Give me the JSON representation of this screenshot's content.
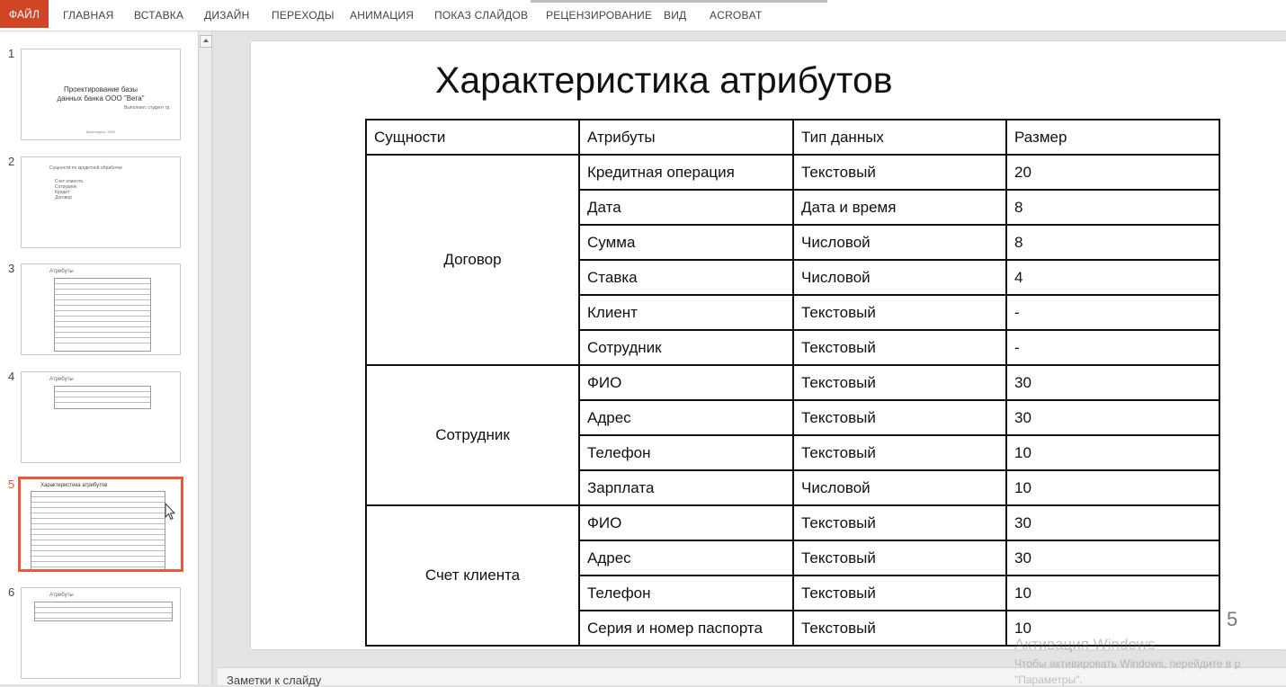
{
  "ribbon": {
    "tabs": [
      "ФАЙЛ",
      "ГЛАВНАЯ",
      "ВСТАВКА",
      "ДИЗАЙН",
      "ПЕРЕХОДЫ",
      "АНИМАЦИЯ",
      "ПОКАЗ СЛАЙДОВ",
      "РЕЦЕНЗИРОВАНИЕ",
      "ВИД",
      "ACROBAT"
    ],
    "active_color": "#d04525"
  },
  "thumbnails": {
    "numbers": [
      "1",
      "2",
      "3",
      "4",
      "5",
      "6"
    ],
    "selected": "5",
    "selected_color": "#e8593a",
    "s1_title": "Проектирование базы данных банка ООО \"Вега\"",
    "s1_author": "Выполнил: студент гр.",
    "s1_footer": "Красноярск, 2020",
    "s2_title": "Сущности по кредитной обработке",
    "s2_bullets": [
      "Счет клиента",
      "Сотрудник",
      "Кредит",
      "Договор"
    ],
    "s3_title": "Атрибуты",
    "s4_title": "Атрибуты",
    "s5_title": "Характеристика атрибутов",
    "s6_title": "Атрибуты"
  },
  "slide": {
    "title": "Характеристика атрибутов",
    "number": "5",
    "headers": [
      "Сущности",
      "Атрибуты",
      "Тип данных",
      "Размер"
    ],
    "entities": [
      "Договор",
      "Сотрудник",
      "Счет клиента"
    ],
    "rows": [
      [
        "Кредитная операция",
        "Текстовый",
        "20"
      ],
      [
        "Дата",
        "Дата  и время",
        "8"
      ],
      [
        "Сумма",
        "Числовой",
        "8"
      ],
      [
        "Ставка",
        "Числовой",
        "4"
      ],
      [
        "Клиент",
        "Текстовый",
        "-"
      ],
      [
        "Сотрудник",
        "Текстовый",
        "-"
      ],
      [
        "ФИО",
        "Текстовый",
        "30"
      ],
      [
        "Адрес",
        "Текстовый",
        "30"
      ],
      [
        "Телефон",
        "Текстовый",
        "10"
      ],
      [
        "Зарплата",
        "Числовой",
        "10"
      ],
      [
        "ФИО",
        "Текстовый",
        "30"
      ],
      [
        "Адрес",
        "Текстовый",
        "30"
      ],
      [
        "Телефон",
        "Текстовый",
        "10"
      ],
      [
        "Серия и номер паспорта",
        "Текстовый",
        "10"
      ]
    ]
  },
  "notes": {
    "label": "Заметки к слайду"
  },
  "watermark": {
    "line1": "Активация Windows",
    "line2": "Чтобы активировать Windows, перейдите в р",
    "line3": "\"Параметры\"."
  }
}
